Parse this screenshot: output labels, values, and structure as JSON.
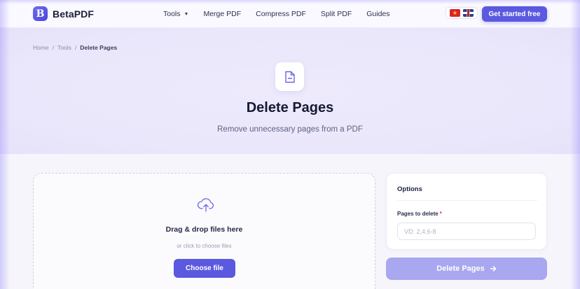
{
  "brand": {
    "name": "BetaPDF",
    "logo_letter": "B"
  },
  "nav": {
    "items": [
      {
        "label": "Tools",
        "has_dropdown": true
      },
      {
        "label": "Merge PDF"
      },
      {
        "label": "Compress PDF"
      },
      {
        "label": "Split PDF"
      },
      {
        "label": "Guides"
      }
    ],
    "languages": [
      "vietnamese-flag-icon",
      "uk-flag-icon"
    ],
    "cta_label": "Get started free"
  },
  "breadcrumb": {
    "home": "Home",
    "sep": "/",
    "tools": "Tools",
    "current": "Delete Pages"
  },
  "hero": {
    "icon": "document-minus-icon",
    "title": "Delete Pages",
    "subtitle": "Remove unnecessary pages from a PDF"
  },
  "upload": {
    "icon": "cloud-upload-icon",
    "title": "Drag & drop files here",
    "subtitle": "or click to choose files",
    "button_label": "Choose file"
  },
  "options": {
    "title": "Options",
    "pages_label": "Pages to delete",
    "required_mark": "*",
    "pages_placeholder": "VD: 2,4,6-8",
    "pages_value": ""
  },
  "action": {
    "label": "Delete Pages",
    "icon": "arrow-right-icon"
  },
  "colors": {
    "accent": "#5a59e0",
    "accent_disabled": "#a9a7ef",
    "hero_bg": "#ebe7fb",
    "required": "#e0324b"
  }
}
